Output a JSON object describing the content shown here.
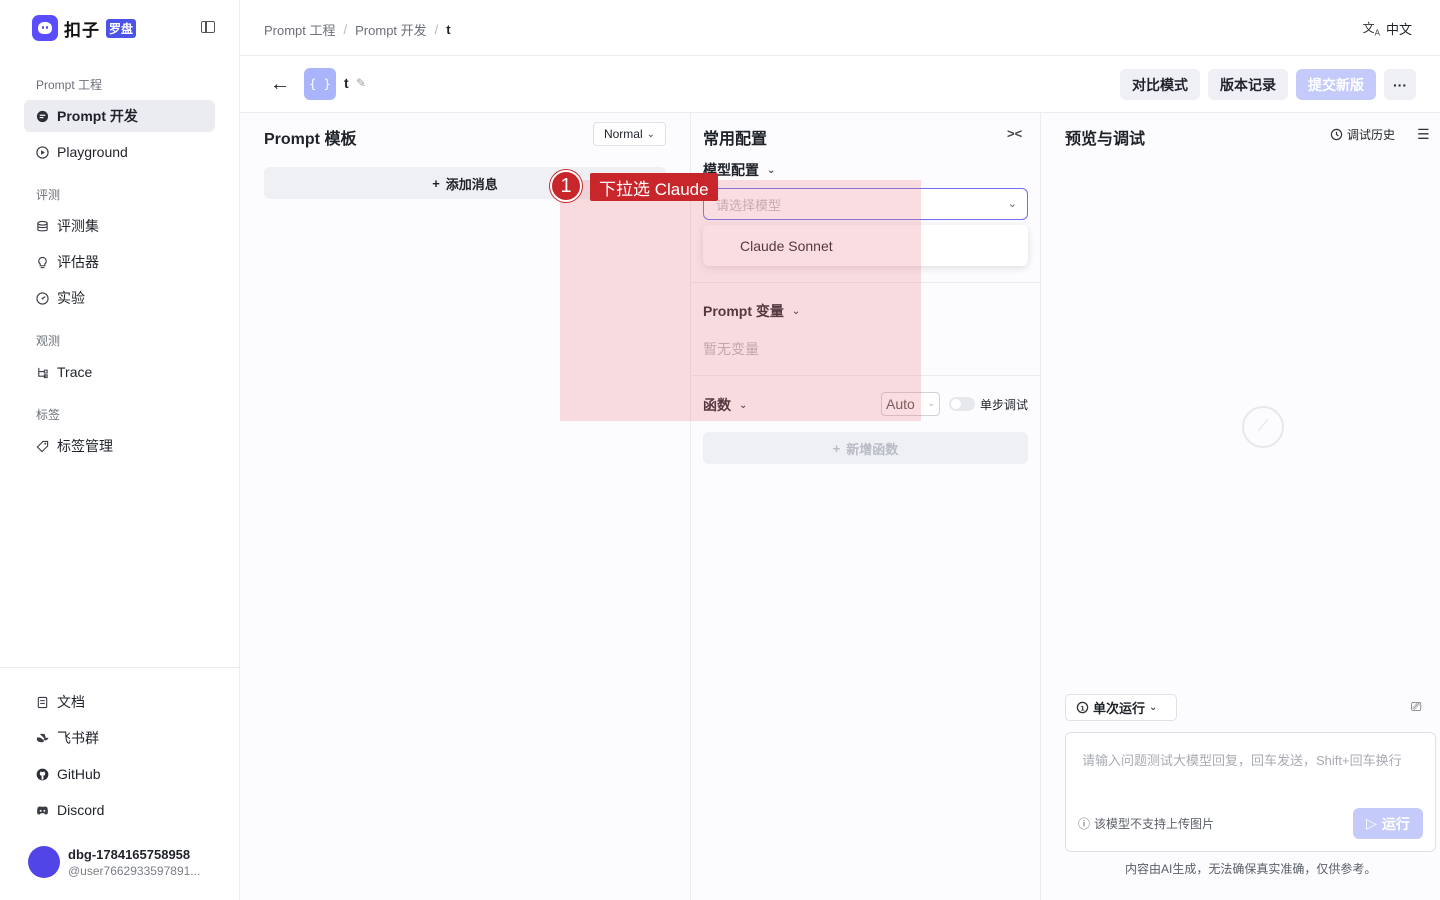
{
  "sidebar": {
    "logo_text": "扣子",
    "logo_badge": "罗盘",
    "sections": {
      "prompt": "Prompt 工程",
      "eval": "评测",
      "observe": "观测",
      "tag": "标签"
    },
    "items": {
      "prompt_dev": "Prompt 开发",
      "playground": "Playground",
      "dataset": "评测集",
      "evaluator": "评估器",
      "experiment": "实验",
      "trace": "Trace",
      "tag_manage": "标签管理",
      "docs": "文档",
      "feishu": "飞书群",
      "github": "GitHub",
      "discord": "Discord"
    },
    "user": {
      "name": "dbg-1784165758958",
      "handle": "@user7662933597891..."
    }
  },
  "topbar": {
    "breadcrumb": [
      "Prompt 工程",
      "Prompt 开发",
      "t"
    ],
    "language": "中文"
  },
  "header": {
    "prompt_badge": "{ }",
    "prompt_name": "t",
    "compare_button": "对比模式",
    "version_button": "版本记录",
    "submit_button": "提交新版",
    "more_button": "···"
  },
  "left_panel": {
    "title": "Prompt 模板",
    "mode_select": "Normal",
    "add_message": "添加消息"
  },
  "mid_panel": {
    "title": "常用配置",
    "model_config": "模型配置",
    "model_placeholder": "请选择模型",
    "dropdown_option": "Claude Sonnet",
    "prompt_vars": "Prompt 变量",
    "no_vars": "暂无变量",
    "functions": "函数",
    "function_mode": "Auto",
    "step_debug": "单步调试",
    "add_function": "新增函数"
  },
  "right_panel": {
    "title": "预览与调试",
    "history": "调试历史",
    "run_mode": "单次运行",
    "input_placeholder": "请输入问题测试大模型回复，回车发送，Shift+回车换行",
    "image_note": "该模型不支持上传图片",
    "run_button": "运行",
    "ai_note": "内容由AI生成，无法确保真实准确，仅供参考。"
  },
  "annotation": {
    "step_number": "1",
    "step_text": "下拉选 Claude"
  },
  "colors": {
    "accent": "#4d53e8",
    "primary_disabled": "#c4cbfb",
    "annotation_red": "#c9262b"
  }
}
